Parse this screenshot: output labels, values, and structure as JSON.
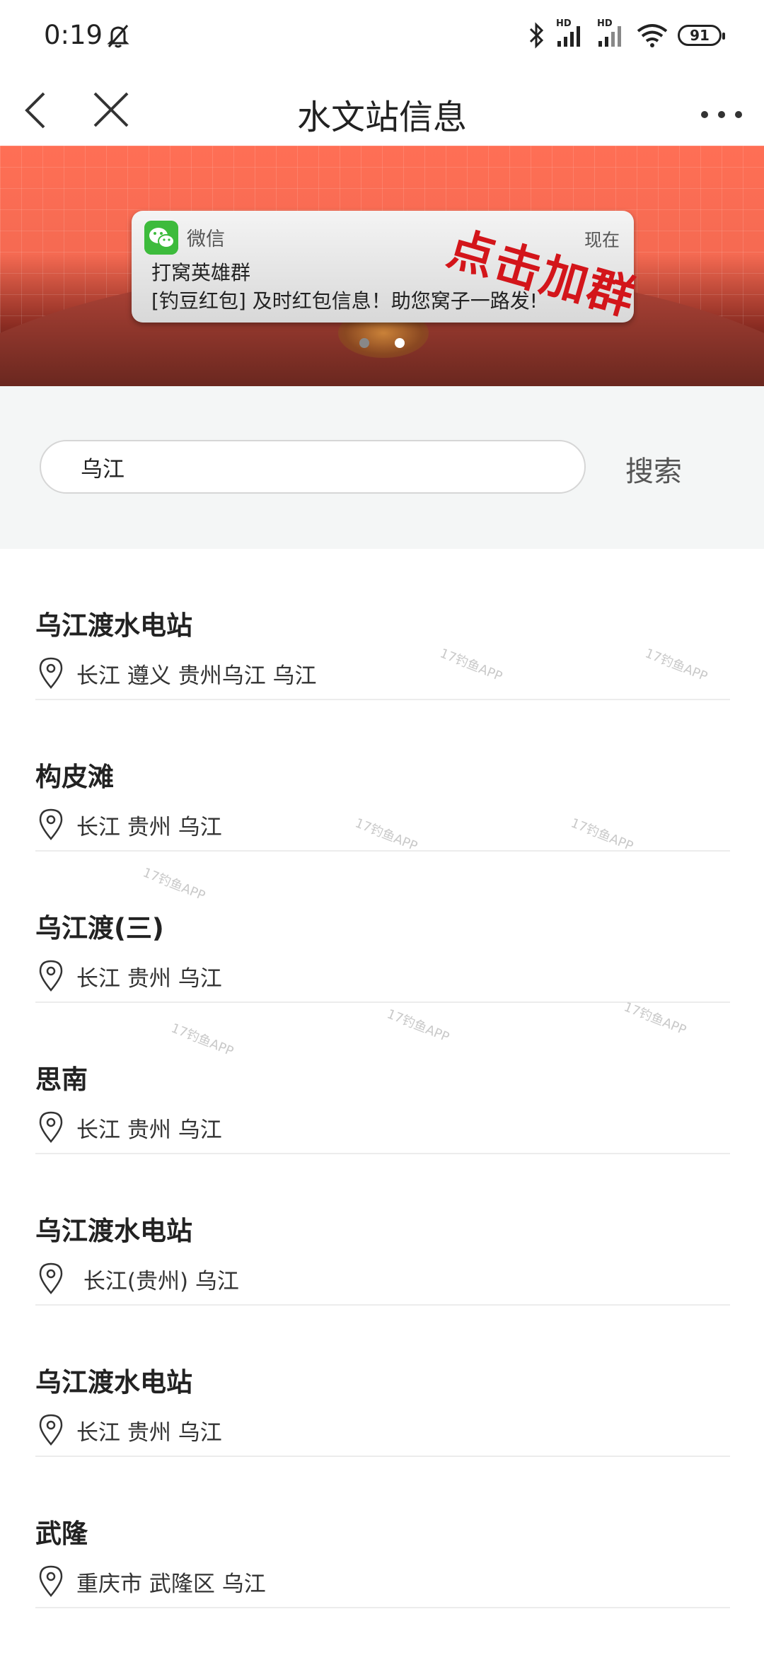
{
  "status_bar": {
    "time": "0:19",
    "hd1": "HD",
    "hd2": "HD",
    "battery": "91"
  },
  "nav": {
    "title": "水文站信息"
  },
  "banner": {
    "notification": {
      "app_name": "微信",
      "time": "现在",
      "title": "打窝英雄群",
      "body": "[钓豆红包] 及时红包信息！助您窝子一路发!"
    },
    "overlay_text": "点击加群",
    "slides": 2,
    "active_slide": 1
  },
  "search": {
    "value": "乌江",
    "button_label": "搜索"
  },
  "stations": [
    {
      "name": "乌江渡水电站",
      "location": "长江 遵义 贵州乌江 乌江"
    },
    {
      "name": "构皮滩",
      "location": "长江 贵州 乌江"
    },
    {
      "name": "乌江渡(三)",
      "location": "长江 贵州 乌江"
    },
    {
      "name": "思南",
      "location": "长江 贵州 乌江"
    },
    {
      "name": "乌江渡水电站",
      "location": " 长江(贵州) 乌江"
    },
    {
      "name": "乌江渡水电站",
      "location": "长江 贵州 乌江"
    },
    {
      "name": "武隆",
      "location": "重庆市 武隆区 乌江"
    }
  ],
  "watermark": {
    "text": "17钓鱼APP"
  },
  "colors": {
    "banner_red": "#f56a52",
    "overlay_red": "#d3151a",
    "wechat_green": "#3dbb3c"
  }
}
